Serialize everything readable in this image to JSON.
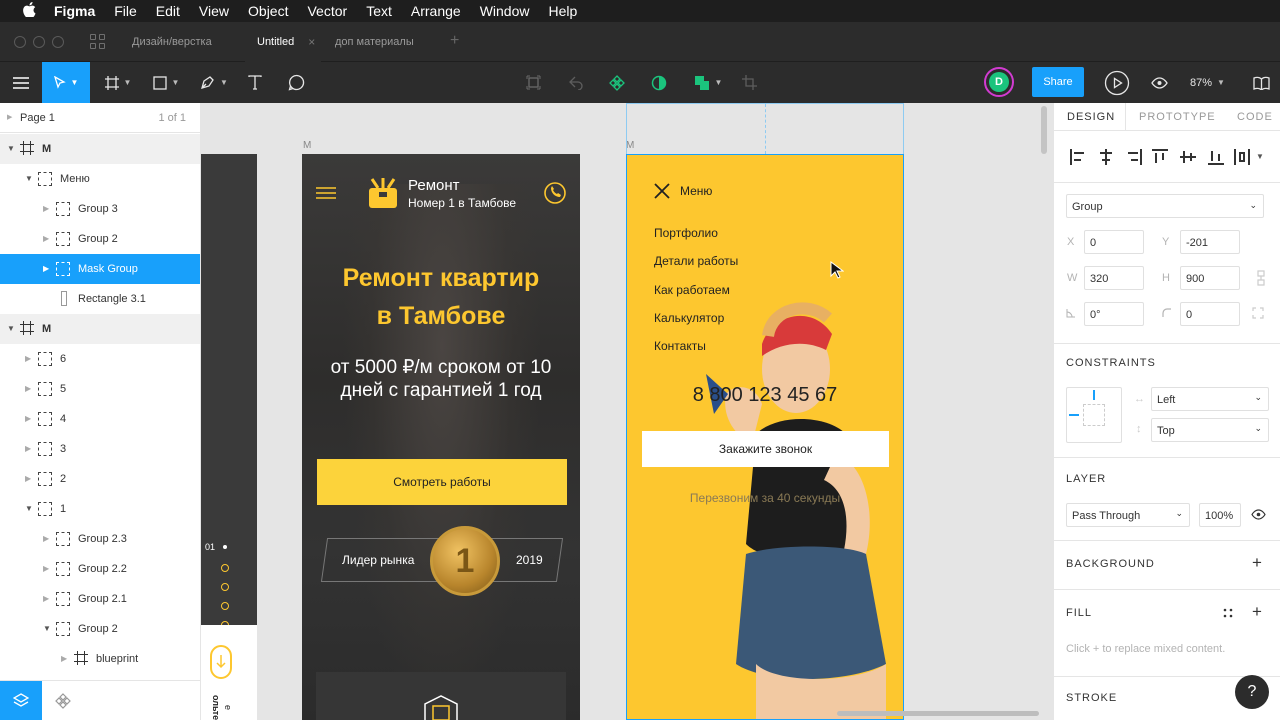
{
  "menubar": {
    "apple": "",
    "items": [
      "Figma",
      "File",
      "Edit",
      "View",
      "Object",
      "Vector",
      "Text",
      "Arrange",
      "Window",
      "Help"
    ]
  },
  "tabs": {
    "items": [
      {
        "label": "Дизайн/верстка"
      },
      {
        "label": "Untitled",
        "close": "×"
      },
      {
        "label": "доп материалы"
      }
    ],
    "add": "+"
  },
  "toolbar": {
    "share": "Share",
    "avatar": "D",
    "zoom": "87%"
  },
  "layers": {
    "page": "Page 1",
    "page_count": "1 of 1",
    "rows": [
      {
        "label": "M"
      },
      {
        "label": "Меню"
      },
      {
        "label": "Group 3"
      },
      {
        "label": "Group 2"
      },
      {
        "label": "Mask Group"
      },
      {
        "label": "Rectangle 3.1"
      },
      {
        "label": "M"
      },
      {
        "label": "6"
      },
      {
        "label": "5"
      },
      {
        "label": "4"
      },
      {
        "label": "3"
      },
      {
        "label": "2"
      },
      {
        "label": "1"
      },
      {
        "label": "Group 2.3"
      },
      {
        "label": "Group 2.2"
      },
      {
        "label": "Group 2.1"
      },
      {
        "label": "Group 2"
      },
      {
        "label": "blueprint"
      }
    ]
  },
  "canvas": {
    "frame_label_mid": "M",
    "frame_label_right": "M",
    "left_frame": {
      "index": "01",
      "side_text_1": "ольте",
      "side_text_2": "е"
    },
    "mid_frame": {
      "brand_title": "Ремонт",
      "brand_sub": "Номер 1 в Тамбове",
      "headline_1": "Ремонт квартир",
      "headline_2": "в Тамбове",
      "sub_1": "от 5000 ₽/м сроком от 10",
      "sub_2": "дней с гарантией 1 год",
      "cta": "Смотреть работы",
      "badge_left": "Лидер рынка",
      "badge_num": "1",
      "badge_right": "2019"
    },
    "right_frame": {
      "menu_title": "Меню",
      "menu_items": [
        "Портфолио",
        "Детали работы",
        "Как работаем",
        "Калькулятор",
        "Контакты"
      ],
      "phone": "8 800 123 45 67",
      "call_button": "Закажите звонок",
      "callback_text": "Перезвоним за 40 секунды"
    }
  },
  "design": {
    "tabs": [
      "DESIGN",
      "PROTOTYPE",
      "CODE"
    ],
    "type": "Group",
    "x_label": "X",
    "x": "0",
    "y_label": "Y",
    "y": "-201",
    "w_label": "W",
    "w": "320",
    "h_label": "H",
    "h": "900",
    "rotation": "0°",
    "radius": "0",
    "constraints_title": "CONSTRAINTS",
    "constraint_h": "Left",
    "constraint_v": "Top",
    "layer_title": "LAYER",
    "blend": "Pass Through",
    "opacity": "100%",
    "background_title": "BACKGROUND",
    "fill_title": "FILL",
    "fill_hint": "Click + to replace mixed content.",
    "stroke_title": "STROKE",
    "help": "?"
  },
  "colors": {
    "accent": "#18a0fb",
    "brand_yellow": "#fdc72f",
    "cta_yellow": "#fcd33b",
    "dark_ui": "#2c2c2c"
  }
}
